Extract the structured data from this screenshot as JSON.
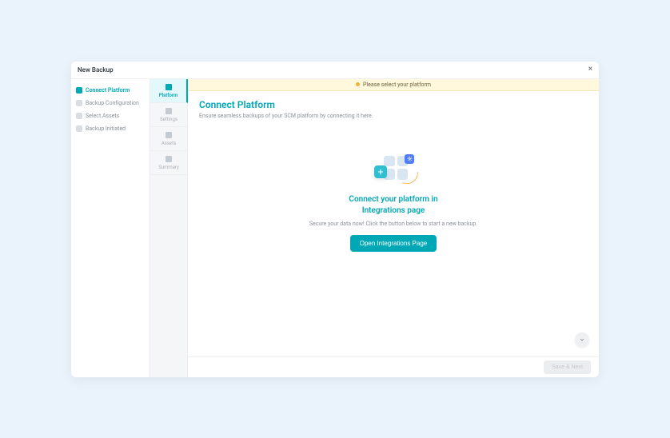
{
  "header": {
    "title": "New Backup"
  },
  "stepper": {
    "items": [
      {
        "label": "Connect Platform",
        "active": true
      },
      {
        "label": "Backup Configuration",
        "active": false
      },
      {
        "label": "Select Assets",
        "active": false
      },
      {
        "label": "Backup Initiated",
        "active": false
      }
    ]
  },
  "rail": {
    "items": [
      {
        "label": "Platform",
        "active": true
      },
      {
        "label": "Settings",
        "active": false
      },
      {
        "label": "Assets",
        "active": false
      },
      {
        "label": "Summary",
        "active": false
      }
    ]
  },
  "alert": {
    "text": "Please select your platform"
  },
  "section": {
    "title": "Connect Platform",
    "subtitle": "Ensure seamless backups of your SCM platform by connecting it here."
  },
  "hero": {
    "title_line1": "Connect your platform in",
    "title_line2": "Integrations page",
    "subtitle": "Secure your data now! Click the button below to start a new backup.",
    "button_label": "Open Integrations Page"
  },
  "footer": {
    "save_next_label": "Save & Next"
  }
}
